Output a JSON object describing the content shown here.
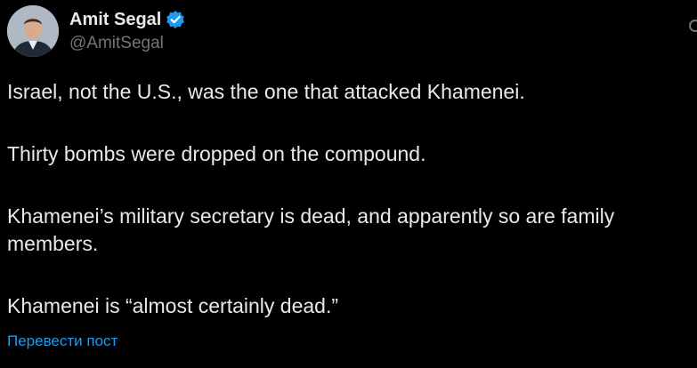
{
  "author": {
    "name": "Amit Segal",
    "handle": "@AmitSegal",
    "verified_icon": "verified-badge-icon",
    "verified_color": "#1d9bf0"
  },
  "tweet": {
    "paragraphs": [
      "Israel, not the U.S., was the one that attacked Khamenei.",
      "Thirty bombs were dropped on the compound.",
      "Khamenei’s military secretary is dead, and apparently so are family members.",
      "Khamenei is “almost certainly dead.”"
    ],
    "translate_label": "Перевести пост"
  },
  "colors": {
    "background": "#000000",
    "text": "#e7e9ea",
    "secondary": "#71767b",
    "link": "#1d9bf0"
  }
}
